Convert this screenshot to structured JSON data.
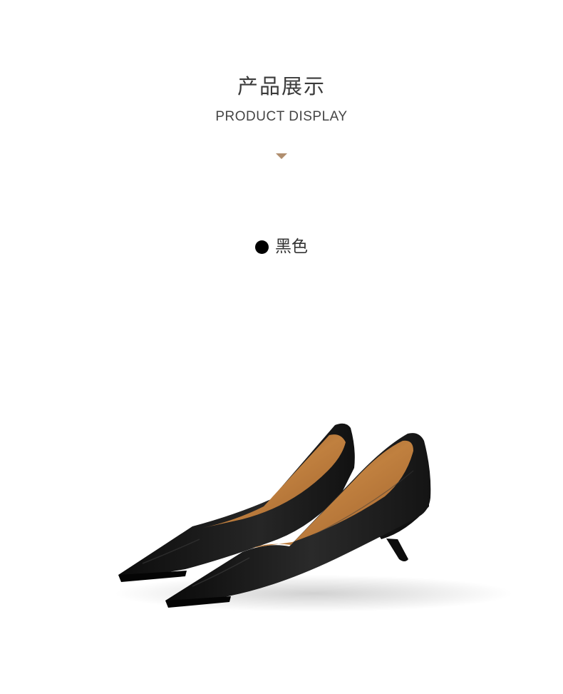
{
  "header": {
    "title": "产品展示",
    "subtitle": "PRODUCT DISPLAY"
  },
  "colors": {
    "accent": "#b08e6e",
    "swatch": "#000000",
    "leather": "#141414",
    "lining": "#b8733a"
  },
  "variant": {
    "color_name": "黑色"
  },
  "product_image": {
    "subject": "pair of black pointed-toe kitten-heel pumps"
  }
}
